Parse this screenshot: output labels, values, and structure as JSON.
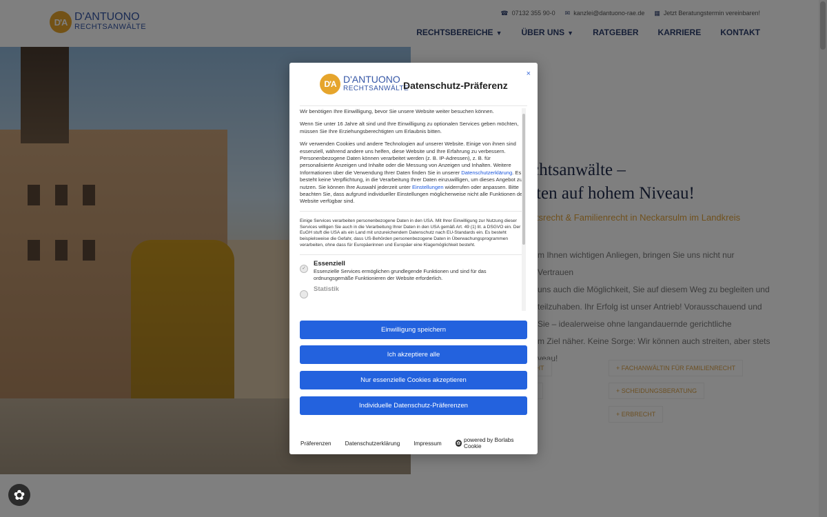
{
  "brand": {
    "line1": "D'ANTUONO",
    "line2": "RECHTSANWÄLTE",
    "mark": "D'A",
    "accent": "#e6a52c",
    "blue": "#3556a6"
  },
  "topbar": {
    "phone": "07132 355 90-0",
    "email": "kanzlei@dantuono-rae.de",
    "appointment": "Jetzt Beratungstermin vereinbaren!"
  },
  "nav": [
    {
      "label": "RECHTSBEREICHE",
      "dropdown": true
    },
    {
      "label": "ÜBER UNS",
      "dropdown": true
    },
    {
      "label": "RATGEBER",
      "dropdown": false
    },
    {
      "label": "KARRIERE",
      "dropdown": false
    },
    {
      "label": "KONTAKT",
      "dropdown": false
    }
  ],
  "hero": {
    "line1": "echtsanwälte –",
    "line2": "eiten auf hohem Niveau!",
    "sub": "itsrecht & Familienrecht in Neckarsulm im Landkreis",
    "para": [
      "m Ihnen wichtigen Anliegen, bringen Sie uns nicht nur Vertrauen",
      "uns auch die Möglichkeit, Sie auf diesem Weg zu begleiten und",
      "teilzuhaben. Ihr Erfolg ist unser Antrieb! Vorausschauend und",
      "Sie – idealerweise ohne langandauernde gerichtliche",
      "m Ziel näher. Keine Sorge: Wir können auch streiten, aber stets",
      "veau!"
    ],
    "tags": [
      "+ FACHANWÄLTIN FÜR FAMILIENRECHT",
      "+ SCHEIDUNGSBERATUNG",
      "+ ERBRECHT",
      "CHT",
      "T"
    ]
  },
  "modal": {
    "title": "Datenschutz-Präferenz",
    "close": "×",
    "p1": "Wir benötigen Ihre Einwilligung, bevor Sie unsere Website weiter besuchen können.",
    "p2": "Wenn Sie unter 16 Jahre alt sind und Ihre Einwilligung zu optionalen Services geben möchten, müssen Sie Ihre Erziehungsberechtigten um Erlaubnis bitten.",
    "p3a": "Wir verwenden Cookies und andere Technologien auf unserer Website. Einige von ihnen sind essenziell, während andere uns helfen, diese Website und Ihre Erfahrung zu verbessern. Personenbezogene Daten können verarbeitet werden (z. B. IP-Adressen), z. B. für personalisierte Anzeigen und Inhalte oder die Messung von Anzeigen und Inhalten. Weitere Informationen über die Verwendung Ihrer Daten finden Sie in unserer ",
    "p3link": "Datenschutzerklärung",
    "p3b": ". Es besteht keine Verpflichtung, in die Verarbeitung Ihrer Daten einzuwilligen, um dieses Angebot zu nutzen. Sie können Ihre Auswahl jederzeit unter ",
    "p3link2": "Einstellungen",
    "p3c": " widerrufen oder anpassen. Bitte beachten Sie, dass aufgrund individueller Einstellungen möglicherweise nicht alle Funktionen der Website verfügbar sind.",
    "usa": "Einige Services verarbeiten personenbezogene Daten in den USA. Mit Ihrer Einwilligung zur Nutzung dieser Services willigen Sie auch in die Verarbeitung Ihrer Daten in den USA gemäß Art. 49 (1) lit. a DSGVO ein. Der EuGH stuft die USA als ein Land mit unzureichendem Datenschutz nach EU-Standards ein. Es besteht beispielsweise die Gefahr, dass US-Behörden personenbezogene Daten in Überwachungsprogrammen verarbeiten, ohne dass für Europäerinnen und Europäer eine Klagemöglichkeit besteht.",
    "cat1_title": "Essenziell",
    "cat1_desc": "Essenzielle Services ermöglichen grundlegende Funktionen und sind für das ordnungsgemäße Funktionieren der Website erforderlich.",
    "cat2_title": "Statistik",
    "btn_save": "Einwilligung speichern",
    "btn_accept_all": "Ich akzeptiere alle",
    "btn_essential": "Nur essenzielle Cookies akzeptieren",
    "btn_individual": "Individuelle Datenschutz-Präferenzen",
    "footer_prefs": "Präferenzen",
    "footer_privacy": "Datenschutzerklärung",
    "footer_imprint": "Impressum",
    "footer_powered": "powered by Borlabs Cookie",
    "button_color": "#2362de"
  }
}
